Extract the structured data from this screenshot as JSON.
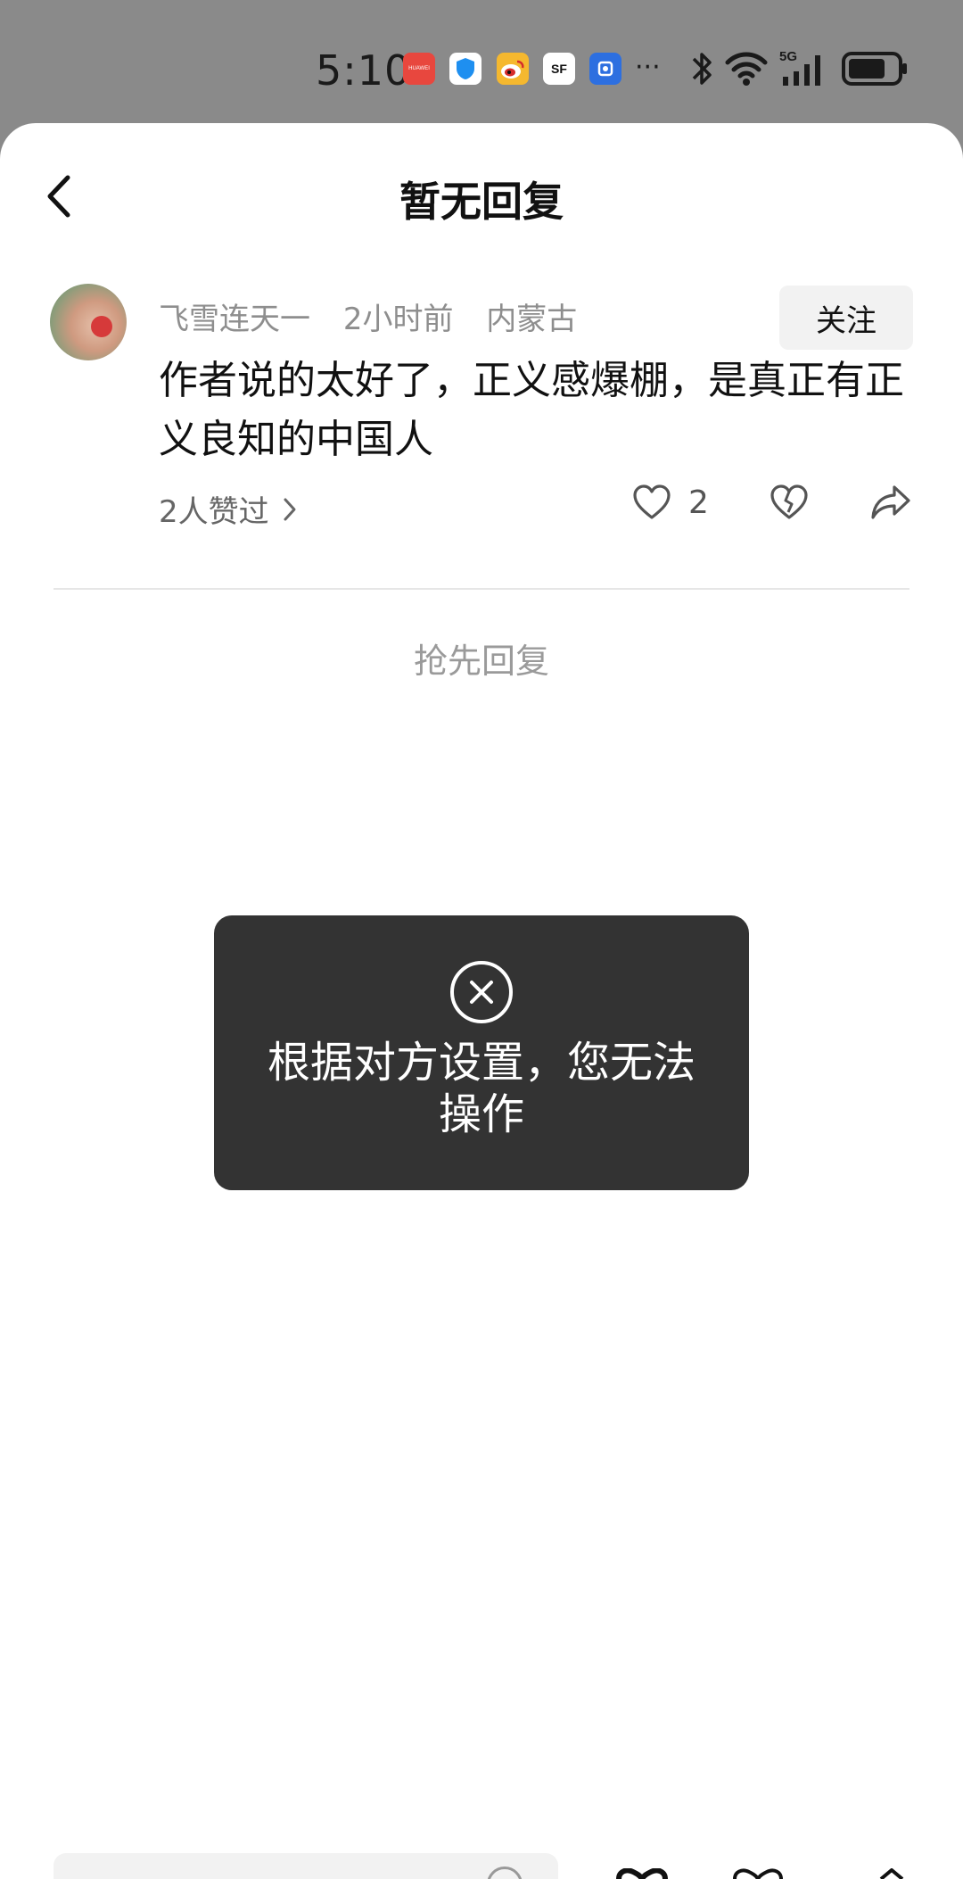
{
  "status_bar": {
    "time": "5:10",
    "icons": [
      "huawei-appgallery-icon",
      "security-shield-icon",
      "weibo-icon",
      "sf-express-icon",
      "blue-app-icon",
      "more-dots-icon",
      "bluetooth-icon",
      "wifi-icon",
      "5g-signal-icon",
      "battery-icon"
    ],
    "huawei_label": "HUAWEI",
    "sf_label": "SF",
    "more": "···",
    "network": "5G"
  },
  "header": {
    "title": "暂无回复"
  },
  "comment": {
    "username": "飞雪连天一",
    "time_ago": "2小时前",
    "location": "内蒙古",
    "follow_label": "关注",
    "text": "作者说的太好了，正义感爆棚，是真正有正义良知的中国人",
    "likers_label": "2人赞过",
    "like_count": "2"
  },
  "replies": {
    "empty_prompt": "抢先回复"
  },
  "toast": {
    "message": "根据对方设置，您无法操作"
  },
  "colors": {
    "status_bar_bg": "#8a8a8a",
    "toast_bg": "#333333",
    "meta_text": "#8e8e8e",
    "follow_bg": "#f2f2f2"
  }
}
